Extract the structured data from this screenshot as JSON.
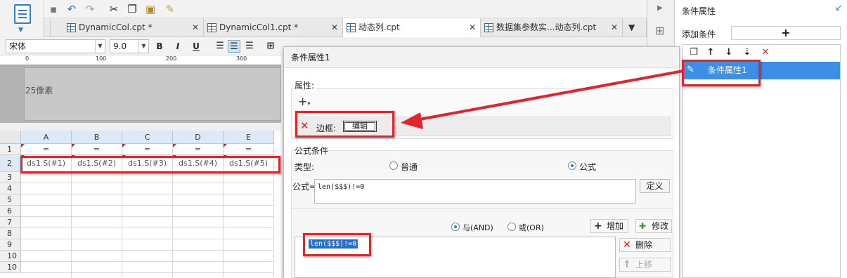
{
  "toolbar": {
    "icons": [
      "save-icon",
      "undo-icon",
      "redo-icon",
      "cut-icon",
      "copy-icon",
      "paste-icon",
      "format-brush-icon"
    ]
  },
  "tabs": [
    {
      "label": "DynamicCol.cpt *"
    },
    {
      "label": "DynamicCol1.cpt *"
    },
    {
      "label": "动态列.cpt"
    },
    {
      "label": "数据集参数实...动态列.cpt"
    }
  ],
  "format": {
    "font": "宋体",
    "size": "9.0",
    "bold": "B",
    "italic": "I",
    "underline": "U"
  },
  "ruler": {
    "ticks": [
      "0",
      "100",
      "200",
      "300"
    ]
  },
  "header_area": {
    "label": "25像素"
  },
  "grid": {
    "columns": [
      "A",
      "B",
      "C",
      "D",
      "E"
    ],
    "rows": [
      "1",
      "2",
      "3",
      "4",
      "5",
      "6",
      "7",
      "8",
      "9",
      "10"
    ],
    "row1": [
      "=",
      "=",
      "=",
      "=",
      "="
    ],
    "row2": [
      "ds1.S(#1)",
      "ds1.S(#2)",
      "ds1.S(#3)",
      "ds1.S(#4)",
      "ds1.S(#5)"
    ]
  },
  "right_panel": {
    "title": "条件属性",
    "add_condition_label": "添加条件",
    "add_button": "+",
    "list_item": "条件属性1"
  },
  "dialog": {
    "title": "条件属性1",
    "properties_label": "属性:",
    "plus": "+",
    "border_label": "边框:",
    "edit_button": "编辑",
    "formula_condition_label": "公式条件",
    "type_label": "类型:",
    "type_normal": "普通",
    "type_formula": "公式",
    "type_selected": "公式",
    "formula_label": "公式=",
    "formula_value": "len($$$)!=0",
    "define_button": "定义",
    "and_label": "与(AND)",
    "or_label": "或(OR)",
    "logic_selected": "与(AND)",
    "add_button": "增加",
    "modify_button": "修改",
    "delete_button": "删除",
    "move_up_button": "上移",
    "condition_item": "len($$$)!=0"
  },
  "colors": {
    "accent": "#3d8ee6",
    "annotation": "#e4232a",
    "column_header": "#dde9f6"
  }
}
